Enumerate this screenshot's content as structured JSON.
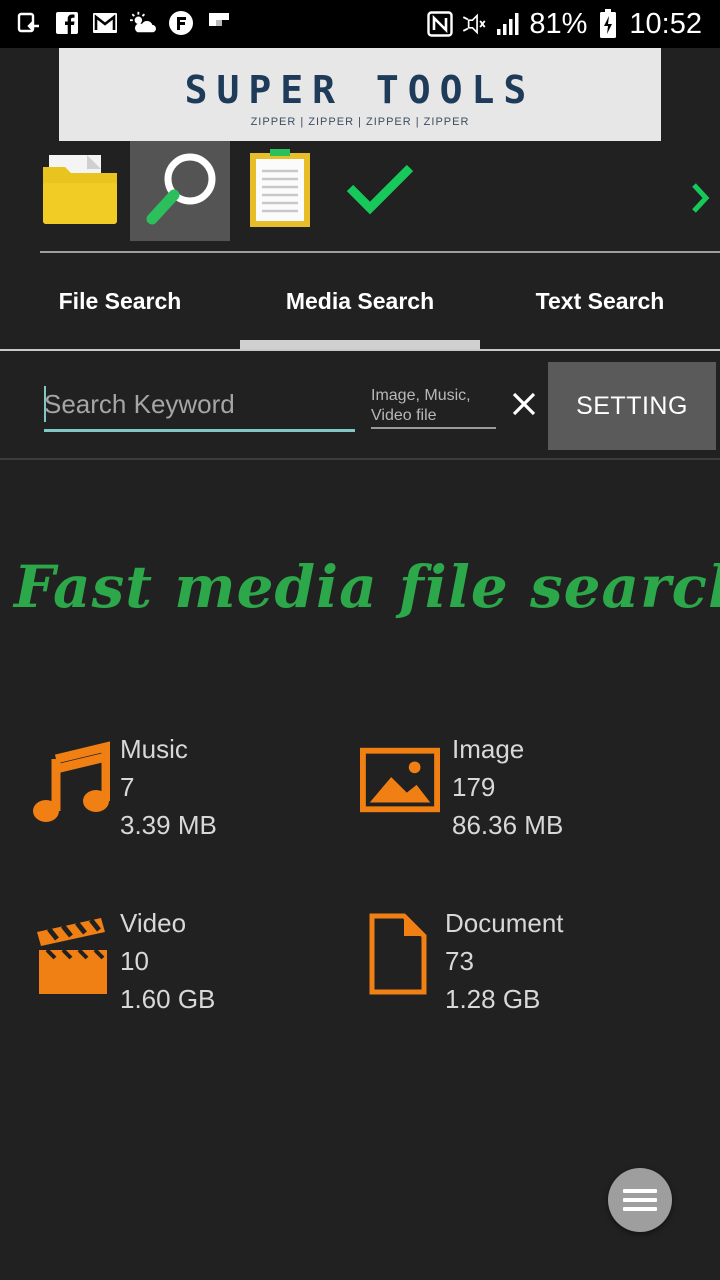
{
  "status_bar": {
    "battery": "81%",
    "time": "10:52",
    "left_icons": [
      "screen-cast-icon",
      "facebook-icon",
      "gmail-icon",
      "weather-icon",
      "notification-app-icon",
      "flipboard-icon"
    ],
    "right_icons": [
      "nfc-icon",
      "mute-icon",
      "signal-icon",
      "battery-charging-icon"
    ]
  },
  "banner": {
    "title": "SUPER TOOLS",
    "subtitle": "ZIPPER | ZIPPER | ZIPPER | ZIPPER"
  },
  "tools": [
    {
      "name": "folder-icon",
      "selected": false
    },
    {
      "name": "search-magnifier-icon",
      "selected": true
    },
    {
      "name": "notepad-icon",
      "selected": false
    },
    {
      "name": "checkmark-icon",
      "selected": false
    }
  ],
  "tabs": [
    {
      "label": "File Search"
    },
    {
      "label": "Media Search",
      "active": true
    },
    {
      "label": "Text Search"
    }
  ],
  "search": {
    "placeholder": "Search Keyword",
    "type_placeholder": "Image, Music, Video file",
    "setting_label": "SETTING"
  },
  "headline": "Fast media file search",
  "media": [
    {
      "label": "Music",
      "count": "7",
      "size": "3.39 MB",
      "icon": "music-note-icon"
    },
    {
      "label": "Image",
      "count": "179",
      "size": "86.36 MB",
      "icon": "image-icon"
    },
    {
      "label": "Video",
      "count": "10",
      "size": "1.60 GB",
      "icon": "video-clapper-icon"
    },
    {
      "label": "Document",
      "count": "73",
      "size": "1.28 GB",
      "icon": "document-icon"
    }
  ],
  "colors": {
    "background": "#212121",
    "accent_orange": "#f07f14",
    "headline_green": "#2ca84a",
    "check_green": "#16c95a",
    "input_underline": "#7fc8c3"
  }
}
